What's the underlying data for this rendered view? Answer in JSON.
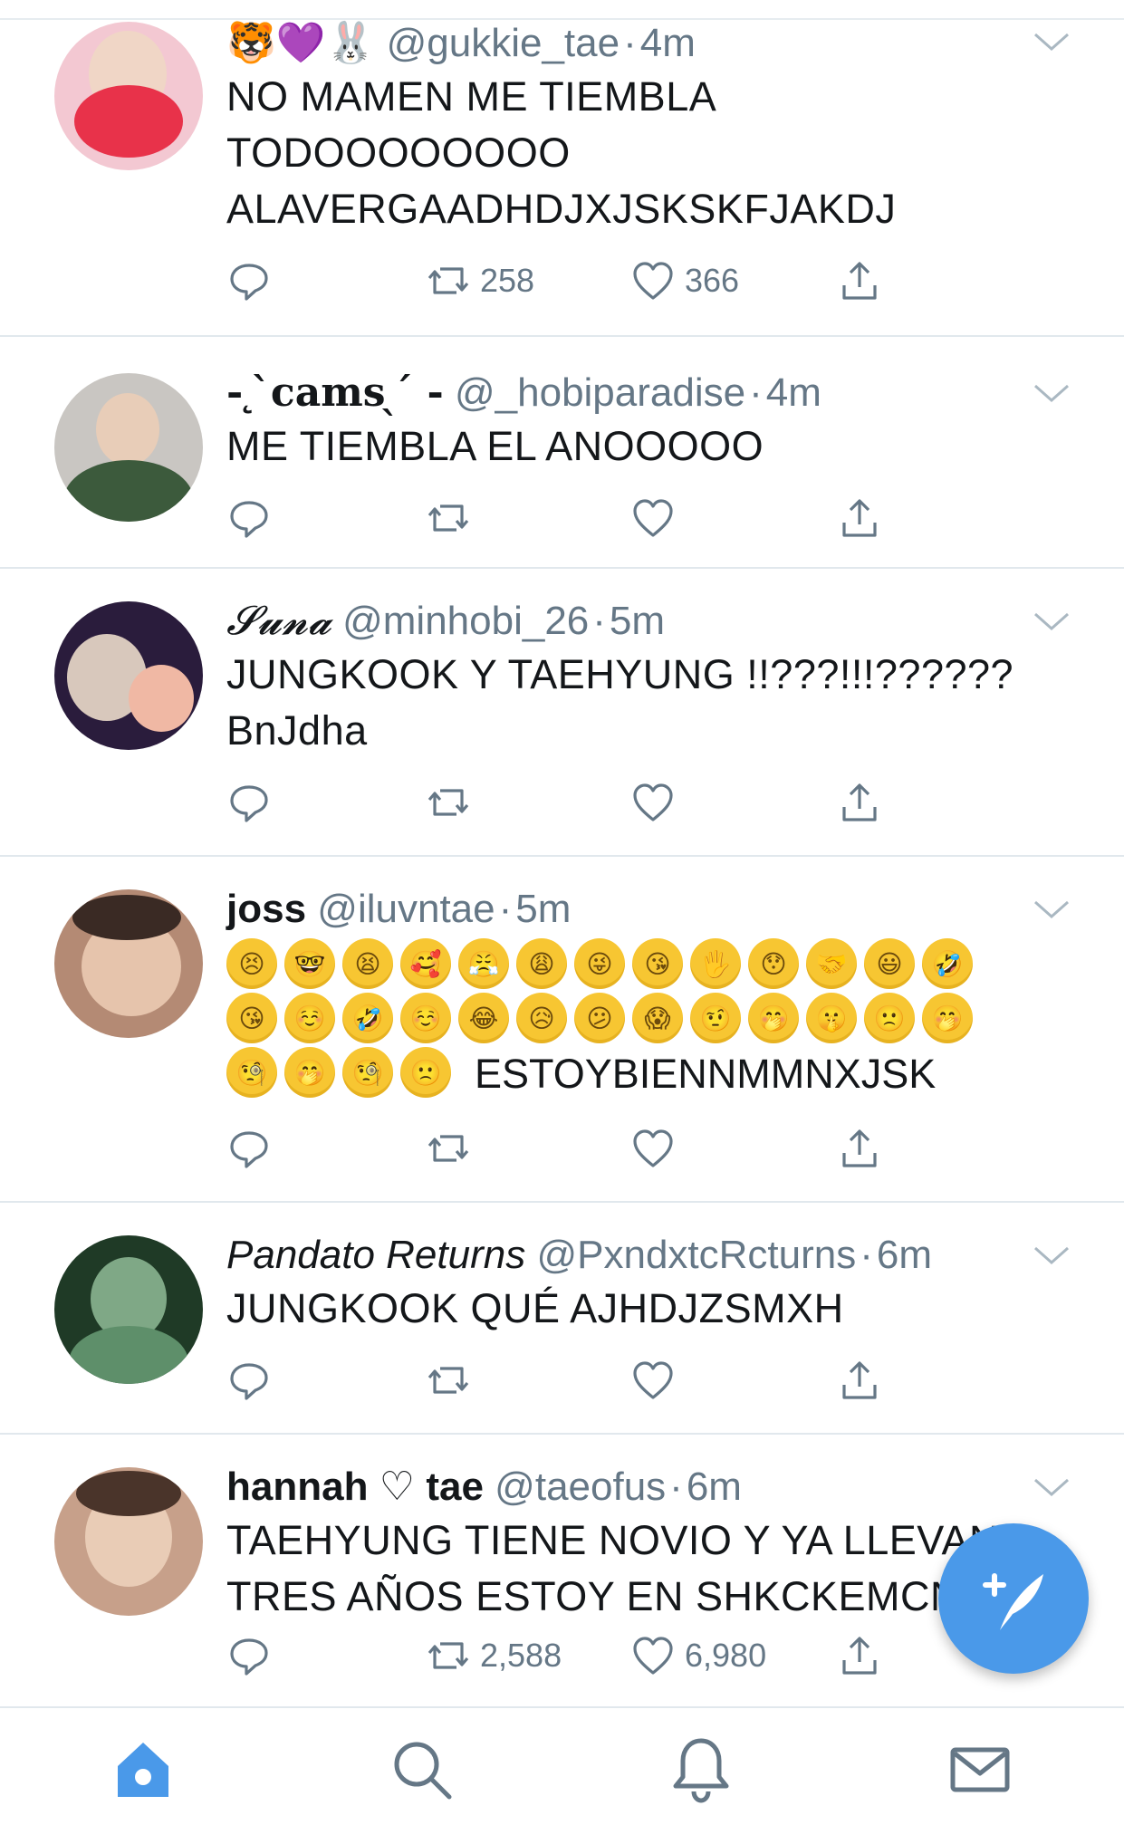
{
  "tweets": [
    {
      "name": "🐯💜🐰",
      "handle": "@gukkie_tae",
      "time": "4m",
      "lines": [
        "NO MAMEN ME TIEMBLA",
        "TODOOOOOOOO",
        "ALAVERGAADHDJXJSKSKFJAKDJ"
      ],
      "retweets": "258",
      "likes": "366",
      "avatar_color": "#f3c8d2"
    },
    {
      "name": "- ̨ ̀cams ̖ ́ -",
      "handle": "@_hobiparadise",
      "time": "4m",
      "lines": [
        "ME TIEMBLA EL ANOOOOO"
      ],
      "retweets": "",
      "likes": "",
      "avatar_color": "#c9c6c2"
    },
    {
      "name": "𝓢𝓾𝓷𝓪",
      "handle": "@minhobi_26",
      "time": "5m",
      "lines": [
        "JUNGKOOK Y TAEHYUNG !!???!!!??????",
        "BnJdha"
      ],
      "retweets": "",
      "likes": "",
      "avatar_color": "#2a1c3c"
    },
    {
      "name": "joss",
      "handle": "@iluvntae",
      "time": "5m",
      "emoji_rows": [
        [
          "😣",
          "🤓",
          "😫",
          "🥰",
          "😤",
          "😩",
          "😜",
          "😘",
          "🖐",
          "😯",
          "🤝",
          "😃",
          "🤣"
        ],
        [
          "😘",
          "☺️",
          "🤣",
          "☺️",
          "😂",
          "😥",
          "😕",
          "😱",
          "🤨",
          "🤭",
          "🤫",
          "🙁",
          "🤭"
        ],
        [
          "🧐",
          "🤭",
          "🧐",
          "🙁"
        ]
      ],
      "emoji_tail": "ESTOYBIENNMMNXJSK",
      "retweets": "",
      "likes": "",
      "avatar_color": "#b48a74"
    },
    {
      "name": "Pandato Returns",
      "handle": "@PxndxtcRcturns",
      "time": "6m",
      "lines": [
        "JUNGKOOK QUÉ AJHDJZSMXH"
      ],
      "retweets": "",
      "likes": "",
      "avatar_color": "#1f3a26"
    },
    {
      "name": "hannah ♡ tae",
      "handle": "@taeofus",
      "time": "6m",
      "lines": [
        "TAEHYUNG TIENE NOVIO Y YA LLEVAN",
        "TRES AÑOS ESTOY EN SHKCKEMCN"
      ],
      "retweets": "2,588",
      "likes": "6,980",
      "avatar_color": "#c7a08a"
    }
  ],
  "colors": {
    "accent": "#4a99e9",
    "secondary_text": "#657786",
    "divider": "#e1e8ed"
  },
  "tabbar": {
    "items": [
      "home-icon",
      "search-icon",
      "notifications-icon",
      "messages-icon"
    ],
    "active": "home-icon"
  },
  "fab_icon": "compose-tweet-icon"
}
